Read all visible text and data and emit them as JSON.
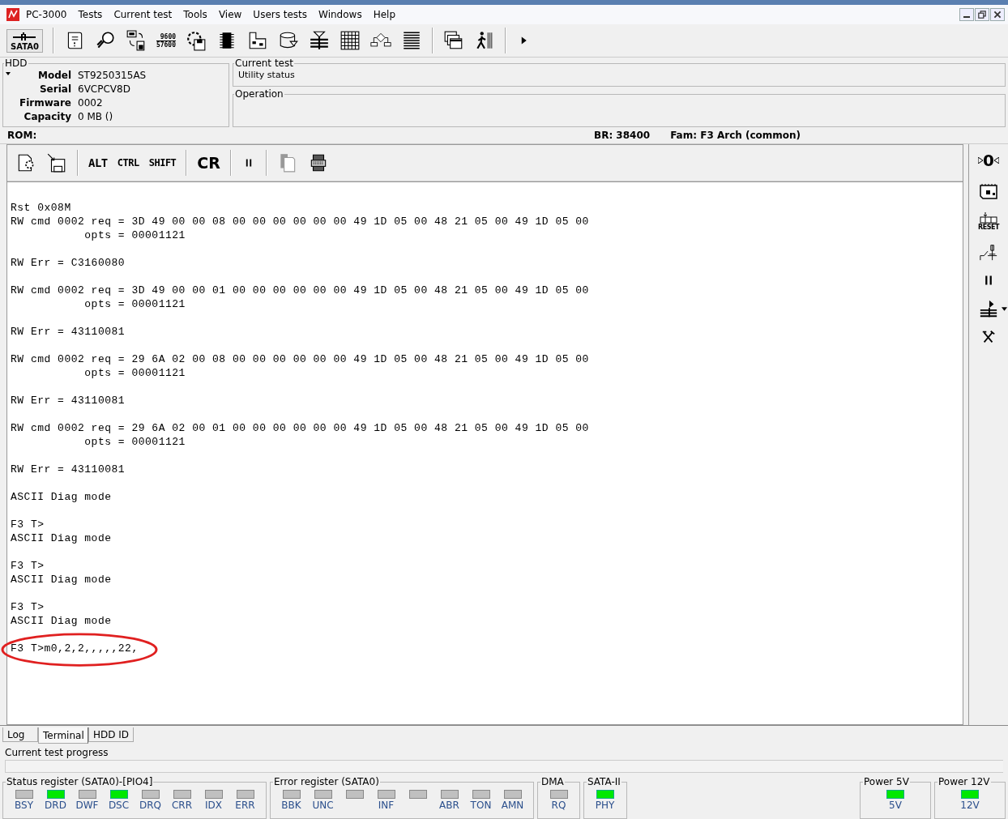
{
  "window": {
    "title": "PC-3000",
    "menu": [
      "Tests",
      "Current test",
      "Tools",
      "View",
      "Users tests",
      "Windows",
      "Help"
    ]
  },
  "toolbar": {
    "port": "SATA0",
    "baud": [
      "9600",
      "57600"
    ]
  },
  "hdd": {
    "title": "HDD",
    "fields": [
      {
        "label": "Model",
        "value": "ST9250315AS"
      },
      {
        "label": "Serial",
        "value": "6VCPCV8D"
      },
      {
        "label": "Firmware",
        "value": "0002"
      },
      {
        "label": "Capacity",
        "value": "0 MB ()"
      }
    ]
  },
  "current_test": {
    "title": "Current test",
    "value": "Utility status"
  },
  "operation": {
    "title": "Operation"
  },
  "rom_bar": {
    "rom": "ROM:",
    "br": "BR: 38400",
    "fam": "Fam: F3 Arch (common)"
  },
  "terminal_toolbar": {
    "keys": [
      "ALT",
      "CTRL",
      "SHIFT"
    ],
    "cr": "CR"
  },
  "terminal": [
    {
      "lines": [
        "Rst 0x08M",
        "RW cmd 0002 req = 3D 49 00 00 08 00 00 00 00 00 00 49 1D 05 00 48 21 05 00 49 1D 05 00",
        "           opts = 00001121"
      ],
      "circled": false
    },
    {
      "lines": [
        "RW Err = C3160080"
      ],
      "circled": false
    },
    {
      "lines": [
        "RW cmd 0002 req = 3D 49 00 00 01 00 00 00 00 00 00 49 1D 05 00 48 21 05 00 49 1D 05 00",
        "           opts = 00001121"
      ],
      "circled": false
    },
    {
      "lines": [
        "RW Err = 43110081"
      ],
      "circled": false
    },
    {
      "lines": [
        "RW cmd 0002 req = 29 6A 02 00 08 00 00 00 00 00 00 49 1D 05 00 48 21 05 00 49 1D 05 00",
        "           opts = 00001121"
      ],
      "circled": false
    },
    {
      "lines": [
        "RW Err = 43110081"
      ],
      "circled": false
    },
    {
      "lines": [
        "RW cmd 0002 req = 29 6A 02 00 01 00 00 00 00 00 00 49 1D 05 00 48 21 05 00 49 1D 05 00",
        "           opts = 00001121"
      ],
      "circled": false
    },
    {
      "lines": [
        "RW Err = 43110081"
      ],
      "circled": false
    },
    {
      "lines": [
        "ASCII Diag mode"
      ],
      "circled": false
    },
    {
      "lines": [
        "F3 T>",
        "ASCII Diag mode"
      ],
      "circled": false
    },
    {
      "lines": [
        "F3 T>",
        "ASCII Diag mode"
      ],
      "circled": false
    },
    {
      "lines": [
        "F3 T>",
        "ASCII Diag mode"
      ],
      "circled": false
    },
    {
      "lines": [
        "F3 T>m0,2,2,,,,,22,"
      ],
      "circled": true
    }
  ],
  "side_toolbar": {
    "zero": "0",
    "reset": "RESET"
  },
  "tabs": [
    {
      "label": "Log",
      "selected": false
    },
    {
      "label": "Terminal",
      "selected": true
    },
    {
      "label": "HDD ID",
      "selected": false
    }
  ],
  "progress": {
    "label": "Current test progress",
    "level": 0
  },
  "registers": [
    {
      "title": "Status register (SATA0)-[PIO4]",
      "leds": [
        {
          "label": "BSY",
          "on": false
        },
        {
          "label": "DRD",
          "on": true
        },
        {
          "label": "DWF",
          "on": false
        },
        {
          "label": "DSC",
          "on": true
        },
        {
          "label": "DRQ",
          "on": false
        },
        {
          "label": "CRR",
          "on": false
        },
        {
          "label": "IDX",
          "on": false
        },
        {
          "label": "ERR",
          "on": false
        }
      ]
    },
    {
      "title": "Error register (SATA0)",
      "leds": [
        {
          "label": "BBK",
          "on": false
        },
        {
          "label": "UNC",
          "on": false
        },
        {
          "on": false
        },
        {
          "label": "INF",
          "on": false
        },
        {
          "on": false
        },
        {
          "label": "ABR",
          "on": false
        },
        {
          "label": "TON",
          "on": false
        },
        {
          "label": "AMN",
          "on": false
        }
      ]
    },
    {
      "title": "DMA",
      "leds": [
        {
          "label": "RQ",
          "on": false
        }
      ]
    },
    {
      "title": "SATA-II",
      "leds": [
        {
          "label": "PHY",
          "on": true
        }
      ]
    }
  ],
  "power": [
    {
      "title": "Power 5V",
      "leds": [
        {
          "label": "5V",
          "on": true
        }
      ]
    },
    {
      "title": "Power 12V",
      "leds": [
        {
          "label": "12V",
          "on": true
        }
      ]
    }
  ]
}
